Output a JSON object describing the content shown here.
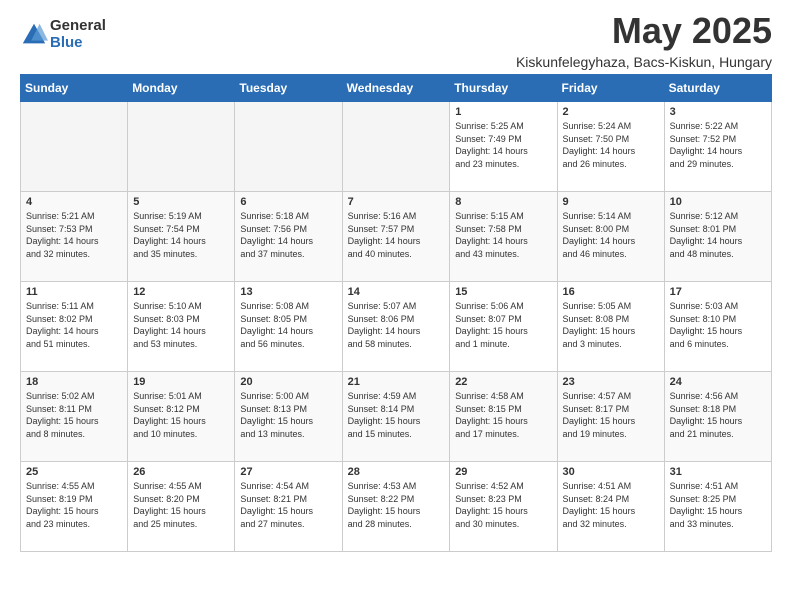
{
  "header": {
    "logo_general": "General",
    "logo_blue": "Blue",
    "month": "May 2025",
    "location": "Kiskunfelegyhaza, Bacs-Kiskun, Hungary"
  },
  "weekdays": [
    "Sunday",
    "Monday",
    "Tuesday",
    "Wednesday",
    "Thursday",
    "Friday",
    "Saturday"
  ],
  "weeks": [
    [
      {
        "day": "",
        "info": ""
      },
      {
        "day": "",
        "info": ""
      },
      {
        "day": "",
        "info": ""
      },
      {
        "day": "",
        "info": ""
      },
      {
        "day": "1",
        "info": "Sunrise: 5:25 AM\nSunset: 7:49 PM\nDaylight: 14 hours\nand 23 minutes."
      },
      {
        "day": "2",
        "info": "Sunrise: 5:24 AM\nSunset: 7:50 PM\nDaylight: 14 hours\nand 26 minutes."
      },
      {
        "day": "3",
        "info": "Sunrise: 5:22 AM\nSunset: 7:52 PM\nDaylight: 14 hours\nand 29 minutes."
      }
    ],
    [
      {
        "day": "4",
        "info": "Sunrise: 5:21 AM\nSunset: 7:53 PM\nDaylight: 14 hours\nand 32 minutes."
      },
      {
        "day": "5",
        "info": "Sunrise: 5:19 AM\nSunset: 7:54 PM\nDaylight: 14 hours\nand 35 minutes."
      },
      {
        "day": "6",
        "info": "Sunrise: 5:18 AM\nSunset: 7:56 PM\nDaylight: 14 hours\nand 37 minutes."
      },
      {
        "day": "7",
        "info": "Sunrise: 5:16 AM\nSunset: 7:57 PM\nDaylight: 14 hours\nand 40 minutes."
      },
      {
        "day": "8",
        "info": "Sunrise: 5:15 AM\nSunset: 7:58 PM\nDaylight: 14 hours\nand 43 minutes."
      },
      {
        "day": "9",
        "info": "Sunrise: 5:14 AM\nSunset: 8:00 PM\nDaylight: 14 hours\nand 46 minutes."
      },
      {
        "day": "10",
        "info": "Sunrise: 5:12 AM\nSunset: 8:01 PM\nDaylight: 14 hours\nand 48 minutes."
      }
    ],
    [
      {
        "day": "11",
        "info": "Sunrise: 5:11 AM\nSunset: 8:02 PM\nDaylight: 14 hours\nand 51 minutes."
      },
      {
        "day": "12",
        "info": "Sunrise: 5:10 AM\nSunset: 8:03 PM\nDaylight: 14 hours\nand 53 minutes."
      },
      {
        "day": "13",
        "info": "Sunrise: 5:08 AM\nSunset: 8:05 PM\nDaylight: 14 hours\nand 56 minutes."
      },
      {
        "day": "14",
        "info": "Sunrise: 5:07 AM\nSunset: 8:06 PM\nDaylight: 14 hours\nand 58 minutes."
      },
      {
        "day": "15",
        "info": "Sunrise: 5:06 AM\nSunset: 8:07 PM\nDaylight: 15 hours\nand 1 minute."
      },
      {
        "day": "16",
        "info": "Sunrise: 5:05 AM\nSunset: 8:08 PM\nDaylight: 15 hours\nand 3 minutes."
      },
      {
        "day": "17",
        "info": "Sunrise: 5:03 AM\nSunset: 8:10 PM\nDaylight: 15 hours\nand 6 minutes."
      }
    ],
    [
      {
        "day": "18",
        "info": "Sunrise: 5:02 AM\nSunset: 8:11 PM\nDaylight: 15 hours\nand 8 minutes."
      },
      {
        "day": "19",
        "info": "Sunrise: 5:01 AM\nSunset: 8:12 PM\nDaylight: 15 hours\nand 10 minutes."
      },
      {
        "day": "20",
        "info": "Sunrise: 5:00 AM\nSunset: 8:13 PM\nDaylight: 15 hours\nand 13 minutes."
      },
      {
        "day": "21",
        "info": "Sunrise: 4:59 AM\nSunset: 8:14 PM\nDaylight: 15 hours\nand 15 minutes."
      },
      {
        "day": "22",
        "info": "Sunrise: 4:58 AM\nSunset: 8:15 PM\nDaylight: 15 hours\nand 17 minutes."
      },
      {
        "day": "23",
        "info": "Sunrise: 4:57 AM\nSunset: 8:17 PM\nDaylight: 15 hours\nand 19 minutes."
      },
      {
        "day": "24",
        "info": "Sunrise: 4:56 AM\nSunset: 8:18 PM\nDaylight: 15 hours\nand 21 minutes."
      }
    ],
    [
      {
        "day": "25",
        "info": "Sunrise: 4:55 AM\nSunset: 8:19 PM\nDaylight: 15 hours\nand 23 minutes."
      },
      {
        "day": "26",
        "info": "Sunrise: 4:55 AM\nSunset: 8:20 PM\nDaylight: 15 hours\nand 25 minutes."
      },
      {
        "day": "27",
        "info": "Sunrise: 4:54 AM\nSunset: 8:21 PM\nDaylight: 15 hours\nand 27 minutes."
      },
      {
        "day": "28",
        "info": "Sunrise: 4:53 AM\nSunset: 8:22 PM\nDaylight: 15 hours\nand 28 minutes."
      },
      {
        "day": "29",
        "info": "Sunrise: 4:52 AM\nSunset: 8:23 PM\nDaylight: 15 hours\nand 30 minutes."
      },
      {
        "day": "30",
        "info": "Sunrise: 4:51 AM\nSunset: 8:24 PM\nDaylight: 15 hours\nand 32 minutes."
      },
      {
        "day": "31",
        "info": "Sunrise: 4:51 AM\nSunset: 8:25 PM\nDaylight: 15 hours\nand 33 minutes."
      }
    ]
  ]
}
